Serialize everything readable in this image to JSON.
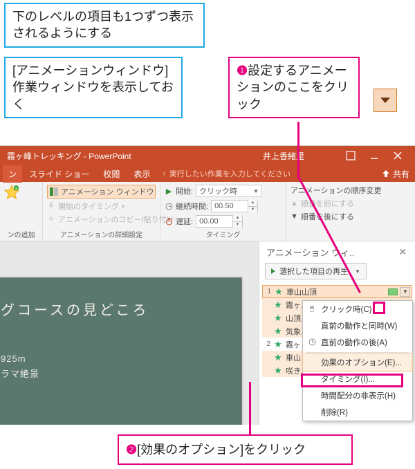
{
  "callouts": {
    "top": "下のレベルの項目も1つずつ表示されるようにする",
    "prep": "[アニメーションウィンドウ]作業ウィンドウを表示しておく",
    "c1": "設定するアニメーションのここをクリック",
    "c1_badge": "❶",
    "c2": "[効果のオプション]をクリック",
    "c2_badge": "❷"
  },
  "titlebar": {
    "title": "霧ヶ峰トレッキング - PowerPoint",
    "user": "井上香緒里"
  },
  "tabs": {
    "t0": "ン",
    "t1": "スライド ショー",
    "t2": "校閲",
    "t3": "表示",
    "tellme": "実行したい作業を入力してください",
    "share": "共有"
  },
  "ribbon": {
    "add_anim": "ンの追加",
    "anim_window": "アニメーション ウィンドウ",
    "trigger": "開始のタイミング",
    "copy_anim": "アニメーションのコピー/貼り付け",
    "group1_label": "アニメーションの詳細設定",
    "start_lbl": "開始:",
    "start_val": "クリック時",
    "dur_lbl": "継続時間:",
    "dur_val": "00.50",
    "delay_lbl": "遅延:",
    "delay_val": "00.00",
    "group2_label": "タイミング",
    "reorder_title": "アニメーションの順序変更",
    "move_earlier": "順番を前にする",
    "move_later": "順番を後にする"
  },
  "slide": {
    "title": "グコースの見どころ",
    "line1": "925m",
    "line2": "ラマ絶景"
  },
  "anim_pane": {
    "title": "アニメーション ウィ..",
    "play": "選択した項目の再生",
    "rows": [
      {
        "n": "1",
        "label": "車山山頂"
      },
      {
        "n": "",
        "label": "霧ヶ…"
      },
      {
        "n": "",
        "label": "山頂…"
      },
      {
        "n": "",
        "label": "気象…"
      },
      {
        "n": "2",
        "label": "霧ヶ…"
      },
      {
        "n": "",
        "label": "車山…"
      },
      {
        "n": "",
        "label": "咲き…"
      }
    ]
  },
  "context_menu": {
    "m0": "クリック時(C)",
    "m1": "直前の動作と同時(W)",
    "m2": "直前の動作の後(A)",
    "m3": "効果のオプション(E)...",
    "m4": "タイミング(I)...",
    "m5": "時間配分の非表示(H)",
    "m6": "削除(R)"
  }
}
